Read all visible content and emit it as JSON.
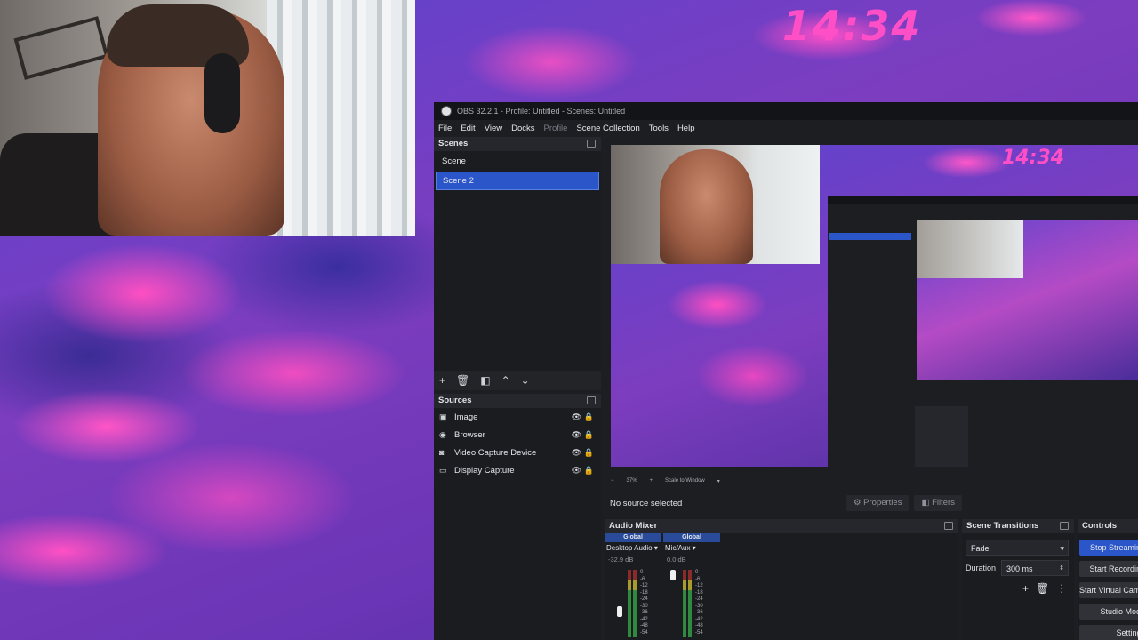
{
  "desktop": {
    "clock": "14:34"
  },
  "window": {
    "title": "OBS 32.2.1 - Profile: Untitled - Scenes: Untitled"
  },
  "menu": {
    "items": [
      "File",
      "Edit",
      "View",
      "Docks",
      "Profile",
      "Scene Collection",
      "Tools",
      "Help"
    ]
  },
  "scenes": {
    "title": "Scenes",
    "items": [
      "Scene",
      "Scene 2"
    ],
    "selected": "Scene 2"
  },
  "sources": {
    "title": "Sources",
    "items": [
      {
        "label": "Image",
        "icon": "image-icon"
      },
      {
        "label": "Browser",
        "icon": "globe-icon"
      },
      {
        "label": "Video Capture Device",
        "icon": "camera-icon"
      },
      {
        "label": "Display Capture",
        "icon": "monitor-icon"
      }
    ]
  },
  "preview": {
    "zoom": "37%",
    "mode": "Scale to Window",
    "clock": "14:34"
  },
  "source_bar": {
    "status": "No source selected",
    "properties": "Properties",
    "filters": "Filters"
  },
  "mixer": {
    "title": "Audio Mixer",
    "channels": [
      {
        "scope": "Global",
        "name": "Desktop Audio",
        "db": "-32.9 dB"
      },
      {
        "scope": "Global",
        "name": "Mic/Aux",
        "db": "0.0 dB"
      }
    ],
    "ticks": [
      "0",
      "-6",
      "-12",
      "-18",
      "-24",
      "-30",
      "-36",
      "-42",
      "-48",
      "-54",
      "-60"
    ]
  },
  "transitions": {
    "title": "Scene Transitions",
    "selected": "Fade",
    "duration_label": "Duration",
    "duration_value": "300 ms"
  },
  "controls": {
    "title": "Controls",
    "buttons": [
      "Stop Streaming",
      "Start Recording",
      "Start Virtual Camera",
      "Studio Mode",
      "Settings"
    ]
  },
  "colors": {
    "accent": "#2b56c9",
    "panel": "#1d1e22",
    "clock": "#ff4fc6"
  }
}
